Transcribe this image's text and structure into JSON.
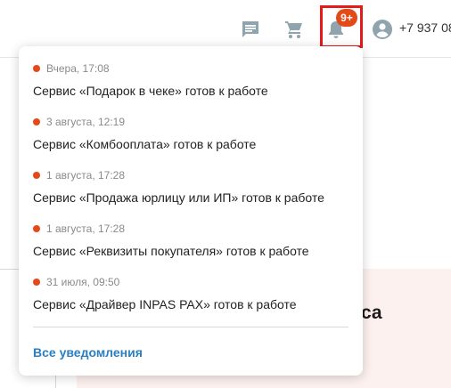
{
  "header": {
    "badge": "9+",
    "phone": "+7 937 08"
  },
  "background": {
    "card_fragment": "са"
  },
  "notifications": {
    "items": [
      {
        "time": "Вчера, 17:08",
        "message": "Сервис «Подарок в чеке» готов к работе"
      },
      {
        "time": "3 августа, 12:19",
        "message": "Сервис «Комбооплата» готов к работе"
      },
      {
        "time": "1 августа, 17:28",
        "message": "Сервис «Продажа юрлицу или ИП» готов к работе"
      },
      {
        "time": "1 августа, 17:28",
        "message": "Сервис «Реквизиты покупателя» готов к работе"
      },
      {
        "time": "31 июля, 09:50",
        "message": "Сервис «Драйвер INPAS PAX» готов к работе"
      }
    ],
    "all_link": "Все уведомления"
  },
  "colors": {
    "accent": "#e34a17",
    "highlight_border": "#e21b1b",
    "link": "#2b7fc0",
    "icon_gray": "#8fa4ad"
  },
  "icons": [
    "chat-icon",
    "cart-icon",
    "bell-icon",
    "user-icon"
  ]
}
